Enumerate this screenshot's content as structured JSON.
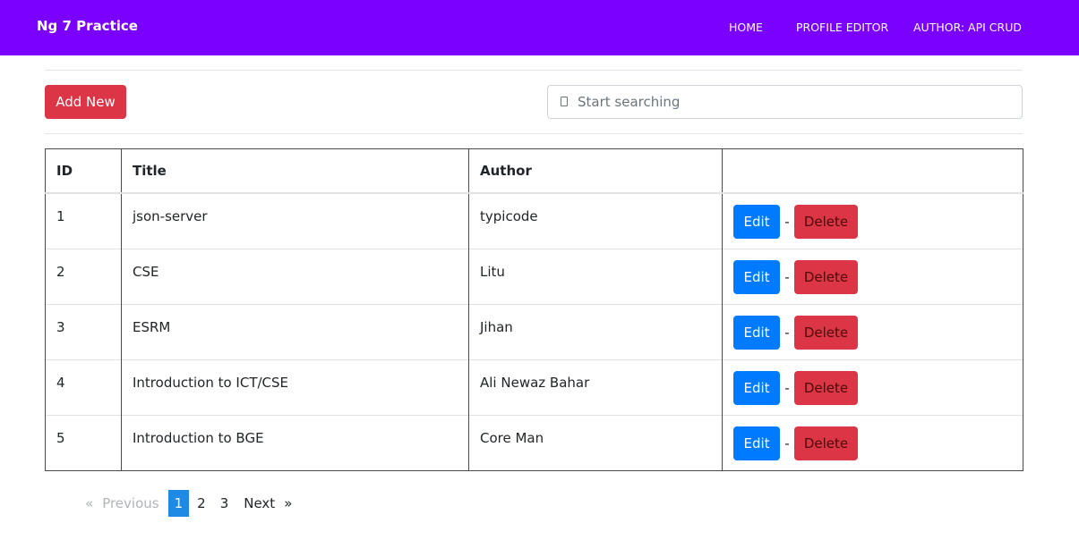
{
  "navbar": {
    "brand": "Ng 7 Practice",
    "links": [
      "HOME",
      "PROFILE EDITOR",
      "AUTHOR: API CRUD"
    ]
  },
  "toolbar": {
    "add_label": "Add New",
    "search_placeholder": "Start searching",
    "search_value": ""
  },
  "table": {
    "headers": [
      "ID",
      "Title",
      "Author",
      ""
    ],
    "rows": [
      {
        "id": "1",
        "title": "json-server",
        "author": "typicode"
      },
      {
        "id": "2",
        "title": "CSE",
        "author": "Litu"
      },
      {
        "id": "3",
        "title": "ESRM",
        "author": "Jihan"
      },
      {
        "id": "4",
        "title": "Introduction to ICT/CSE",
        "author": "Ali Newaz Bahar"
      },
      {
        "id": "5",
        "title": "Introduction to BGE",
        "author": "Core Man"
      }
    ],
    "edit_label": "Edit",
    "separator": "-",
    "delete_label": "Delete"
  },
  "pagination": {
    "prev_symbol": "«",
    "prev_label": "Previous",
    "pages": [
      "1",
      "2",
      "3"
    ],
    "current_page": "1",
    "next_label": "Next",
    "next_symbol": "»"
  },
  "colors": {
    "navbar": "#7a00ff",
    "danger": "#dc3545",
    "primary": "#007bff",
    "page_active": "#1e8ae6"
  }
}
